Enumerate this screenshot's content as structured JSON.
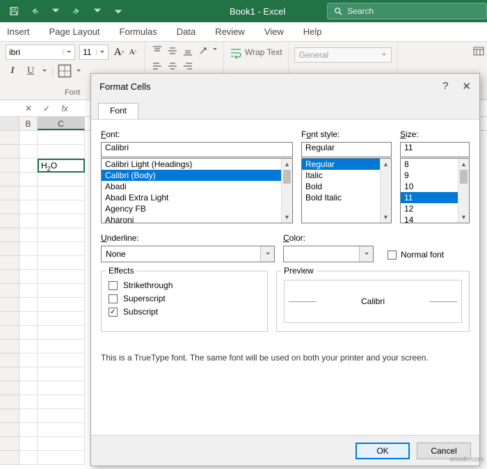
{
  "title": "Book1 - Excel",
  "search": {
    "placeholder": "Search"
  },
  "ribbon_tabs": [
    "Insert",
    "Page Layout",
    "Formulas",
    "Data",
    "Review",
    "View",
    "Help"
  ],
  "ribbon": {
    "font_name": "ibri",
    "font_size": "11",
    "group_font": "Font",
    "wrap_text": "Wrap Text",
    "number_format": "General"
  },
  "grid": {
    "cols": [
      "",
      "B",
      "C"
    ],
    "cell_c3": "H2O"
  },
  "dialog": {
    "title": "Format Cells",
    "tab": "Font",
    "font": {
      "label": "Font:",
      "value": "Calibri",
      "list": [
        "Calibri Light (Headings)",
        "Calibri (Body)",
        "Abadi",
        "Abadi Extra Light",
        "Agency FB",
        "Aharoni"
      ],
      "selected": "Calibri (Body)"
    },
    "style": {
      "label": "Font style:",
      "value": "Regular",
      "list": [
        "Regular",
        "Italic",
        "Bold",
        "Bold Italic"
      ],
      "selected": "Regular"
    },
    "size": {
      "label": "Size:",
      "value": "11",
      "list": [
        "8",
        "9",
        "10",
        "11",
        "12",
        "14"
      ],
      "selected": "11"
    },
    "underline": {
      "label": "Underline:",
      "value": "None"
    },
    "color": {
      "label": "Color:"
    },
    "normal_font": "Normal font",
    "effects": {
      "legend": "Effects",
      "strike": "Strikethrough",
      "super": "Superscript",
      "sub": "Subscript",
      "sub_checked": true
    },
    "preview": {
      "legend": "Preview",
      "sample": "Calibri"
    },
    "description": "This is a TrueType font.  The same font will be used on both your printer and your screen.",
    "ok": "OK",
    "cancel": "Cancel"
  },
  "watermark": "wsxdn.com"
}
